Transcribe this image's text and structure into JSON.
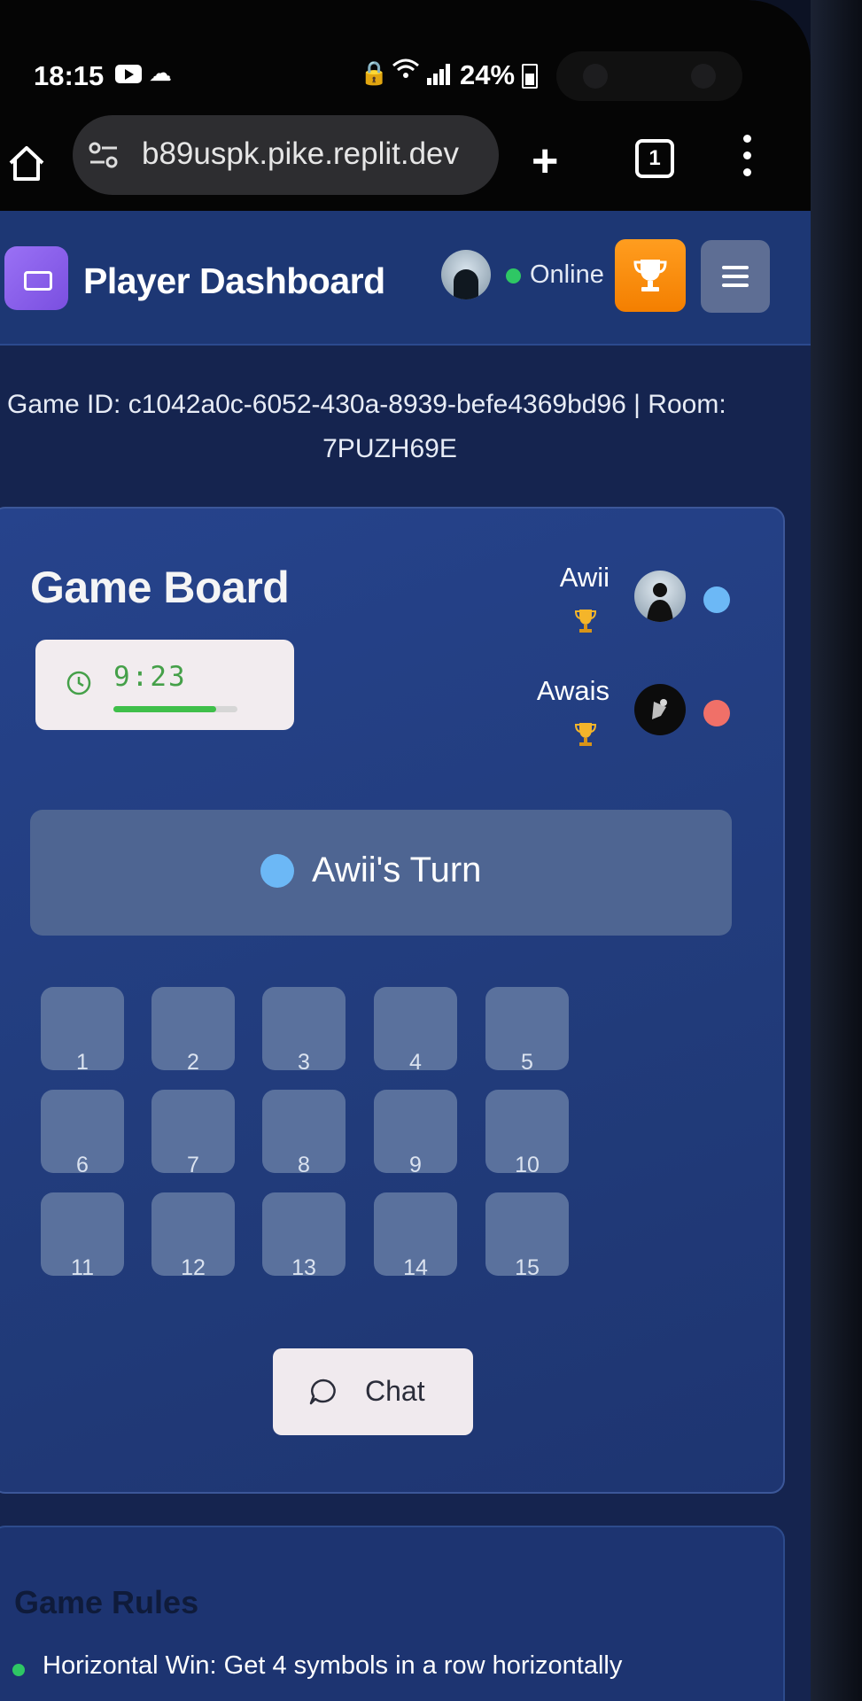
{
  "status_bar": {
    "time": "18:15",
    "battery": "24%"
  },
  "browser": {
    "url": "b89uspk.pike.replit.dev",
    "tab_count": "1"
  },
  "header": {
    "title": "Player Dashboard",
    "status": "Online"
  },
  "game_info": {
    "line1": "Game ID: c1042a0c-6052-430a-8939-befe4369bd96 | Room:",
    "line2": "7PUZH69E"
  },
  "board": {
    "title": "Game Board",
    "timer": "9:23",
    "timer_progress": 0.83,
    "players": [
      {
        "name": "Awii",
        "color": "#6cb8f6"
      },
      {
        "name": "Awais",
        "color": "#f07068"
      }
    ],
    "turn_text": "Awii's Turn",
    "cells": [
      "1",
      "2",
      "3",
      "4",
      "5",
      "6",
      "7",
      "8",
      "9",
      "10",
      "11",
      "12",
      "13",
      "14",
      "15"
    ],
    "chat_label": "Chat"
  },
  "rules": {
    "title": "Game Rules",
    "items": [
      "Horizontal Win: Get 4 symbols in a row horizontally"
    ]
  },
  "colors": {
    "accent_orange": "#f47f00",
    "header_bg": "#1d3774",
    "online": "#2ec764"
  }
}
